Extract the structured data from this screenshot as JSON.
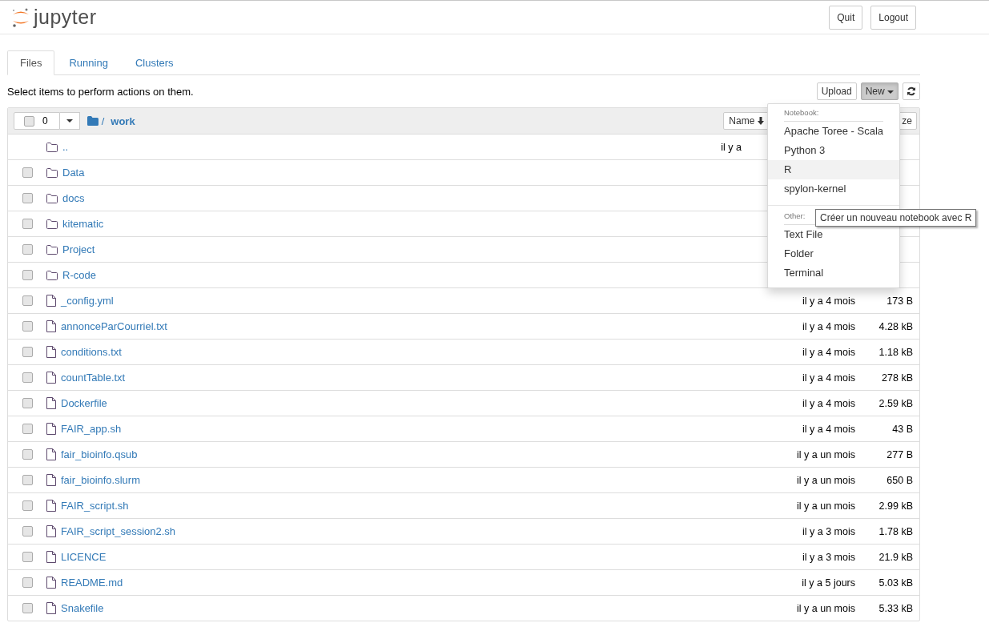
{
  "header": {
    "logo_text": "jupyter",
    "buttons": [
      "Quit",
      "Logout"
    ]
  },
  "tabs": [
    {
      "label": "Files",
      "selected": true
    },
    {
      "label": "Running",
      "selected": false
    },
    {
      "label": "Clusters",
      "selected": false
    }
  ],
  "instructions": "Select items to perform actions on them.",
  "toolbar": {
    "upload": "Upload",
    "new": "New"
  },
  "list_header": {
    "selected_count": "0",
    "checked": false,
    "path_separator": "/",
    "path": "work",
    "sort_button": "Name",
    "size_button": "ze"
  },
  "rows": [
    {
      "kind": "parent",
      "name": "..",
      "modified": "il y a"
    },
    {
      "kind": "folder",
      "name": "Data",
      "checked": false
    },
    {
      "kind": "folder",
      "name": "docs",
      "checked": false
    },
    {
      "kind": "folder",
      "name": "kitematic",
      "checked": false
    },
    {
      "kind": "folder",
      "name": "Project",
      "checked": false
    },
    {
      "kind": "folder",
      "name": "R-code",
      "checked": false
    },
    {
      "kind": "file",
      "name": "_config.yml",
      "checked": false,
      "modified": "il y a 4 mois",
      "size": "173 B"
    },
    {
      "kind": "file",
      "name": "annonceParCourriel.txt",
      "checked": false,
      "modified": "il y a 4 mois",
      "size": "4.28 kB"
    },
    {
      "kind": "file",
      "name": "conditions.txt",
      "checked": false,
      "modified": "il y a 4 mois",
      "size": "1.18 kB"
    },
    {
      "kind": "file",
      "name": "countTable.txt",
      "checked": false,
      "modified": "il y a 4 mois",
      "size": "278 kB"
    },
    {
      "kind": "file",
      "name": "Dockerfile",
      "checked": false,
      "modified": "il y a 4 mois",
      "size": "2.59 kB"
    },
    {
      "kind": "file",
      "name": "FAIR_app.sh",
      "checked": false,
      "modified": "il y a 4 mois",
      "size": "43 B"
    },
    {
      "kind": "file",
      "name": "fair_bioinfo.qsub",
      "checked": false,
      "modified": "il y a un mois",
      "size": "277 B"
    },
    {
      "kind": "file",
      "name": "fair_bioinfo.slurm",
      "checked": false,
      "modified": "il y a un mois",
      "size": "650 B"
    },
    {
      "kind": "file",
      "name": "FAIR_script.sh",
      "checked": false,
      "modified": "il y a un mois",
      "size": "2.99 kB"
    },
    {
      "kind": "file",
      "name": "FAIR_script_session2.sh",
      "checked": false,
      "modified": "il y a 3 mois",
      "size": "1.78 kB"
    },
    {
      "kind": "file",
      "name": "LICENCE",
      "checked": false,
      "modified": "il y a 3 mois",
      "size": "21.9 kB"
    },
    {
      "kind": "file",
      "name": "README.md",
      "checked": false,
      "modified": "il y a 5 jours",
      "size": "5.03 kB"
    },
    {
      "kind": "file",
      "name": "Snakefile",
      "checked": false,
      "modified": "il y a un mois",
      "size": "5.33 kB"
    }
  ],
  "new_menu": {
    "sections": [
      {
        "heading": "Notebook:",
        "items": [
          {
            "label": "Apache Toree - Scala",
            "selected": false
          },
          {
            "label": "Python 3",
            "selected": false
          },
          {
            "label": "R",
            "selected": true
          },
          {
            "label": "spylon-kernel",
            "selected": false
          }
        ]
      },
      {
        "heading": "Other:",
        "items": [
          {
            "label": "Text File",
            "selected": false
          },
          {
            "label": "Folder",
            "selected": false
          },
          {
            "label": "Terminal",
            "selected": false
          }
        ]
      }
    ]
  },
  "tooltip": "Créer un nouveau notebook avec R"
}
